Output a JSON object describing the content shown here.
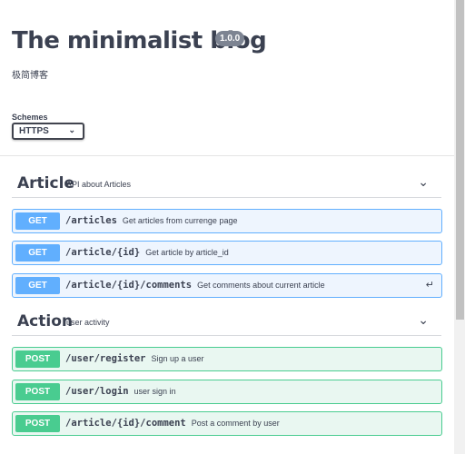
{
  "info": {
    "title": "The minimalist blog",
    "version": "1.0.0",
    "description": "极简博客"
  },
  "schemes": {
    "label": "Schemes",
    "selected": "HTTPS"
  },
  "tags": [
    {
      "name": "Article",
      "description": "API about Articles",
      "operations": [
        {
          "method": "GET",
          "path": "/articles",
          "summary": "Get articles from currenge page"
        },
        {
          "method": "GET",
          "path": "/article/{id}",
          "summary": "Get article by article_id"
        },
        {
          "method": "GET",
          "path": "/article/{id}/comments",
          "summary": "Get comments about current article"
        }
      ]
    },
    {
      "name": "Action",
      "description": "user activity",
      "operations": [
        {
          "method": "POST",
          "path": "/user/register",
          "summary": "Sign up a user"
        },
        {
          "method": "POST",
          "path": "/user/login",
          "summary": "user sign in"
        },
        {
          "method": "POST",
          "path": "/article/{id}/comment",
          "summary": "Post a comment by user"
        }
      ]
    }
  ],
  "colors": {
    "get": "#61affe",
    "post": "#49cc90"
  }
}
